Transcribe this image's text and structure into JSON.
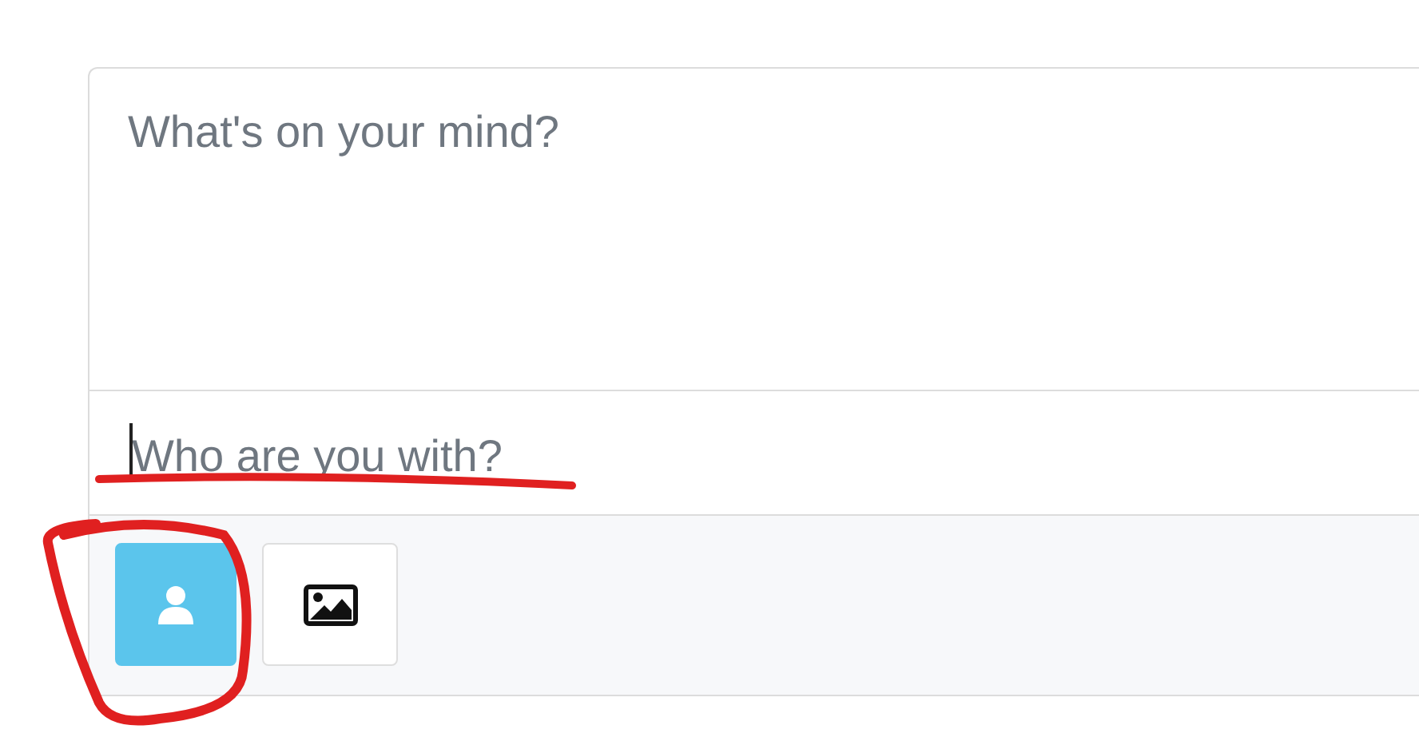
{
  "post_box": {
    "message": {
      "placeholder": "What's on your mind?"
    },
    "with": {
      "placeholder": "Who are you with?",
      "focused": true
    },
    "buttons": [
      {
        "kind": "person",
        "selected": true
      },
      {
        "kind": "image",
        "selected": false
      }
    ]
  },
  "annotations": {
    "underline": {
      "color": "#e02020"
    },
    "circle": {
      "color": "#e02020"
    }
  }
}
